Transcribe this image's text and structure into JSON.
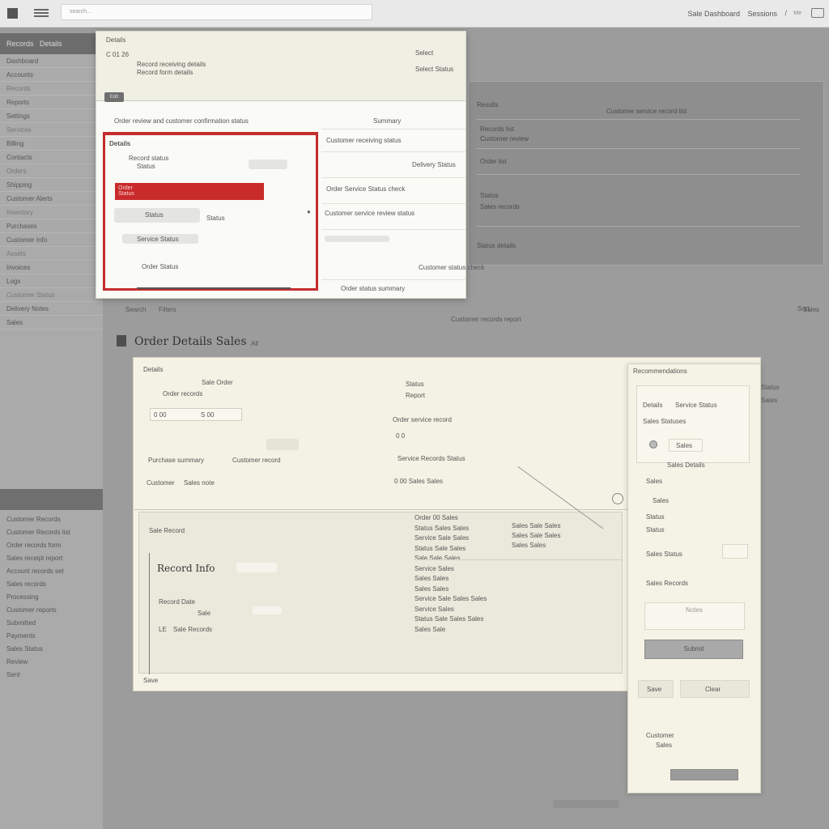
{
  "topbar": {
    "search_placeholder": "search...",
    "right_link_1": "Sale Dashboard",
    "right_link_2": "Sessions",
    "slash": "/",
    "small": "Me"
  },
  "sidebar": {
    "header_1": "Records",
    "header_2": "Details",
    "items": [
      "Dashboard",
      "Accounts",
      "Records",
      "Reports",
      "Settings",
      "Services",
      "Billing",
      "Contacts",
      "Orders",
      "Shipping",
      "Customer Alerts",
      "Inventory",
      "Purchases",
      "Customer Info",
      "Assets",
      "Invoices",
      "Logs",
      "Customer Status",
      "Delivery Notes",
      "Sales"
    ],
    "lower_items": [
      "Customer Records",
      "Customer Records list",
      "Order records form",
      "Sales receipt report",
      "Account records set",
      "Sales records",
      "Processing",
      "Customer reports",
      "Submitted",
      "Payments",
      "Sales Status",
      "Review",
      "Sent"
    ]
  },
  "popup": {
    "title": "Details",
    "subtitle_1": "Record receiving details",
    "subtitle_2": "Record form details",
    "label_code": "C 01 26",
    "right_label_1": "Select",
    "right_label_2": "Select Status",
    "button": "Edit",
    "section_title": "Order review and customer confirmation status",
    "section_right": "Summary",
    "red_title": "Details",
    "red_row_1": "Record status",
    "red_row_2": "Status",
    "red_bar_1": "Order",
    "red_bar_2": "Status",
    "row_a": "Status",
    "row_b": "Status",
    "row_c": "Service Status",
    "row_d": "Order Status",
    "right_rows": [
      "Customer receiving status",
      "Delivery Status",
      "Order Service Status check",
      "Customer service review status",
      "Customer status",
      "Customer status check",
      "Order status summary"
    ]
  },
  "background_panel": {
    "header": "Results",
    "col": "Customer service record list",
    "rows": [
      "Records list",
      "Customer review",
      "Order list",
      "Status",
      "Sales records",
      "Status details"
    ]
  },
  "section": {
    "title": "Order  Details  Sales",
    "icon_label": "All",
    "toolbar_1": "Search",
    "toolbar_2": "Filters",
    "toolbar_right": "Sort",
    "mid_label": "Customer records report"
  },
  "card": {
    "label_top": "Details",
    "name": "Sale Order",
    "name_sub": "Order records",
    "code_field": "0  00",
    "code_value": "S  00",
    "title_right": "Status",
    "title_right_sub": "Report",
    "row_1": "Order service record",
    "row_2_label": "Purchase summary",
    "row_2_value": "Customer record",
    "row_2_right": "Service Records Status",
    "row_3_a": "Customer",
    "row_3_b": "Sales note",
    "row_3_right": "0  00  Sales  Sales",
    "num_a": "0  0",
    "num_b": "0  Sales",
    "inner_label": "Sale Record",
    "inner_title": "Record Info",
    "inner_sub_1": "Record Date",
    "inner_sub_2": "Sale",
    "inner_sub_3": "LE",
    "inner_sub_3b": "Sale Records",
    "mid_col": [
      "Order 00 Sales",
      "Status Sales Sales",
      "Service Sale Sales",
      "Status Sale Sales",
      "Sale Sale Sales",
      "Service Sales",
      "Sales Sales",
      "Sales Sales",
      "Service Sale Sales Sales",
      "Service Sales",
      "Status Sale Sales Sales",
      "Sales Sale"
    ],
    "right_col": [
      "Sales Sale Sales",
      "Sales Sale Sales",
      "Sales Sales"
    ],
    "footer": "Save"
  },
  "side": {
    "header": "Recommendations",
    "row_1": "Details",
    "row_2": "Service Status",
    "row_3": "Sales Statuses",
    "field_value": "Sales",
    "link": "Sales Details",
    "item_1": "Sales",
    "item_2": "Sales",
    "item_3": "Status",
    "item_4": "Status",
    "item_5": "Sales Status",
    "item_6": "Sales Records",
    "textarea_label": "Notes",
    "button": "Submit",
    "mini_1": "Save",
    "mini_2": "Clear",
    "foot_1": "Customer",
    "foot_2": "Sales"
  },
  "right_edge": [
    "Status",
    "Sales",
    "Sales"
  ]
}
